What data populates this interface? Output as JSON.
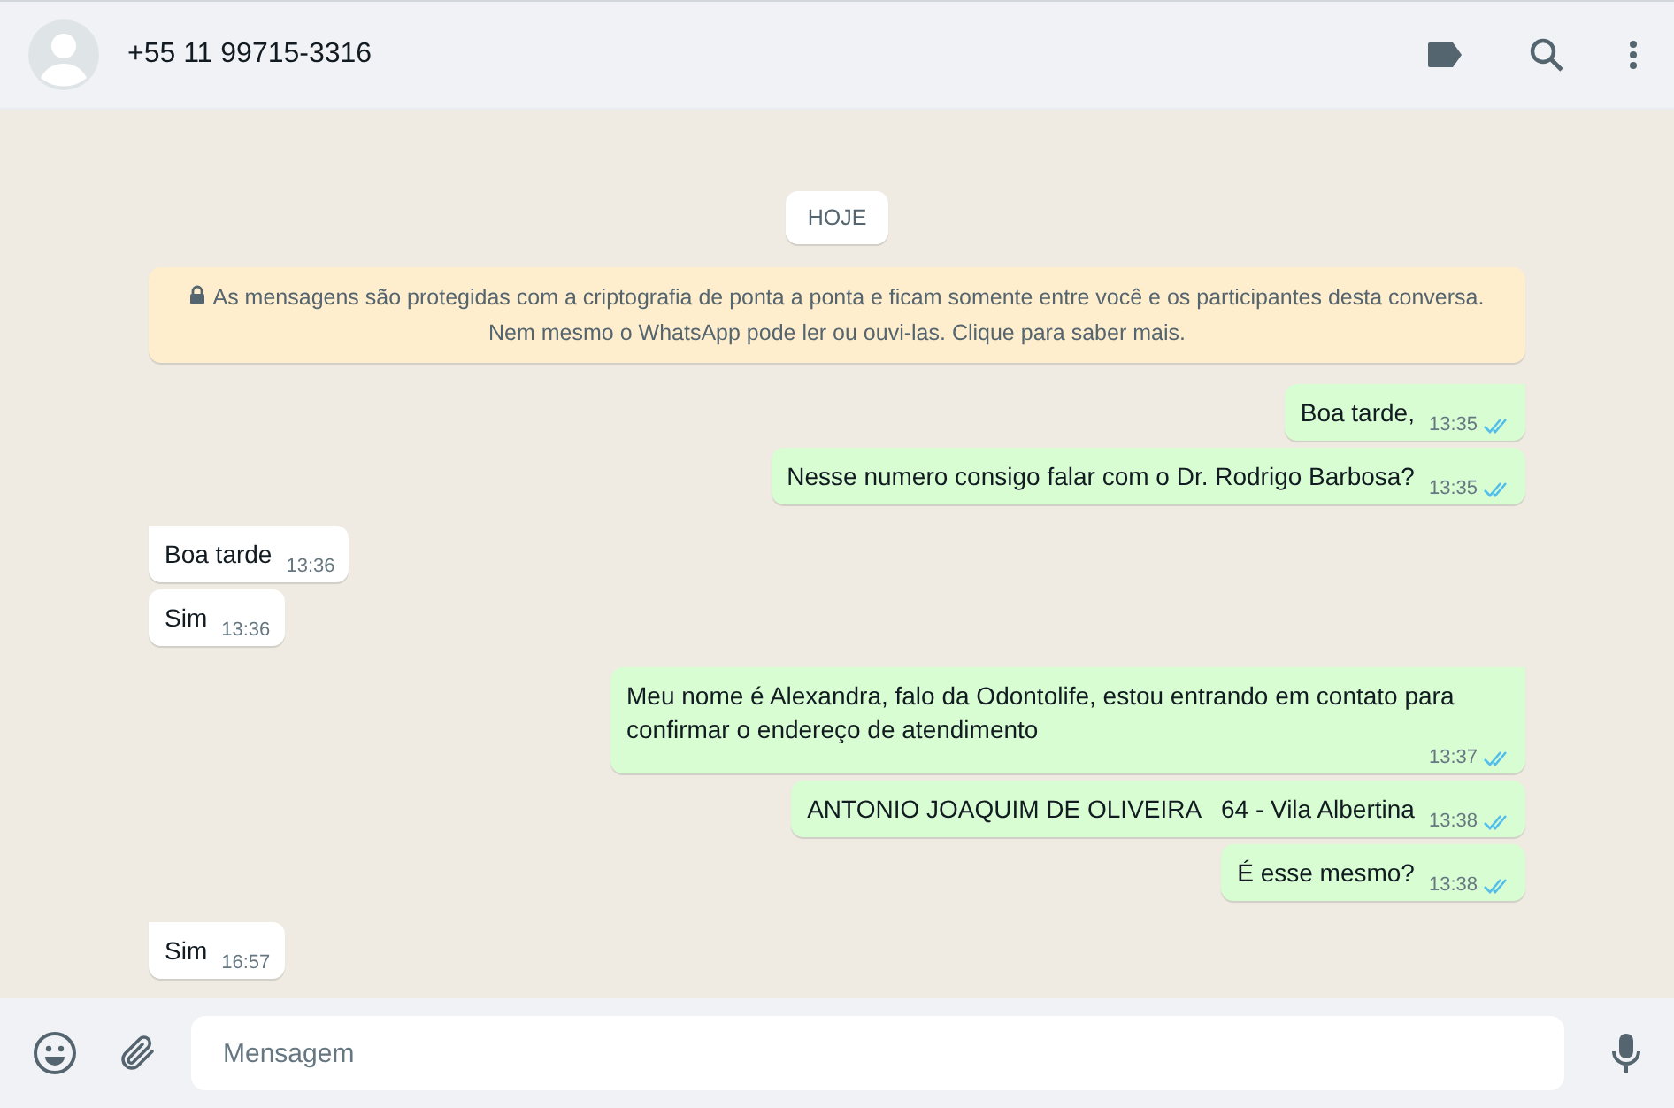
{
  "header": {
    "contact": "+55 11 99715-3316"
  },
  "date_chip": "HOJE",
  "encryption_notice": {
    "line1": "As mensagens são protegidas com a criptografia de ponta a ponta e ficam somente entre você e os participantes desta conversa.",
    "line2": "Nem mesmo o WhatsApp pode ler ou ouvi-las. Clique para saber mais."
  },
  "messages": [
    {
      "kind": "sent",
      "tail": true,
      "text": "Boa tarde,",
      "time": "13:35",
      "read": true
    },
    {
      "kind": "sent",
      "tail": false,
      "text": "Nesse numero consigo falar com o Dr. Rodrigo Barbosa?",
      "time": "13:35",
      "read": true
    },
    {
      "kind": "received",
      "tail": true,
      "text": "Boa tarde",
      "time": "13:36"
    },
    {
      "kind": "received",
      "tail": false,
      "text": "Sim",
      "time": "13:36"
    },
    {
      "kind": "sent",
      "tail": true,
      "text": "Meu nome é Alexandra, falo da Odontolife, estou entrando em contato para confirmar o endereço de atendimento",
      "time": "13:37",
      "read": true
    },
    {
      "kind": "sent",
      "tail": false,
      "text": "ANTONIO JOAQUIM DE OLIVEIRA   64 - Vila Albertina",
      "time": "13:38",
      "read": true
    },
    {
      "kind": "sent",
      "tail": false,
      "text": "É esse mesmo?",
      "time": "13:38",
      "read": true
    },
    {
      "kind": "received",
      "tail": true,
      "text": "Sim",
      "time": "16:57"
    }
  ],
  "composer": {
    "placeholder": "Mensagem"
  }
}
